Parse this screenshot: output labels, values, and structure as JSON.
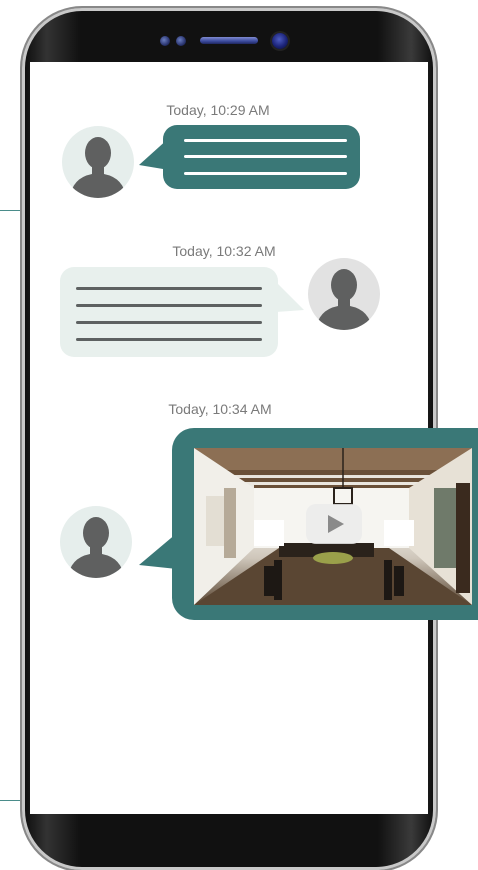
{
  "messages": [
    {
      "timestamp": "Today, 10:29 AM",
      "sender": "other",
      "kind": "text"
    },
    {
      "timestamp": "Today, 10:32 AM",
      "sender": "self",
      "kind": "text"
    },
    {
      "timestamp": "Today, 10:34 AM",
      "sender": "other",
      "kind": "video"
    }
  ],
  "colors": {
    "accent": "#3a7877",
    "incoming_bubble": "#3a7877",
    "outgoing_bubble": "#e8f0ed",
    "timestamp_text": "#7a7a7a",
    "avatar_silhouette": "#5f6060"
  },
  "icons": {
    "play": "play-icon",
    "avatar": "person-silhouette-icon"
  }
}
